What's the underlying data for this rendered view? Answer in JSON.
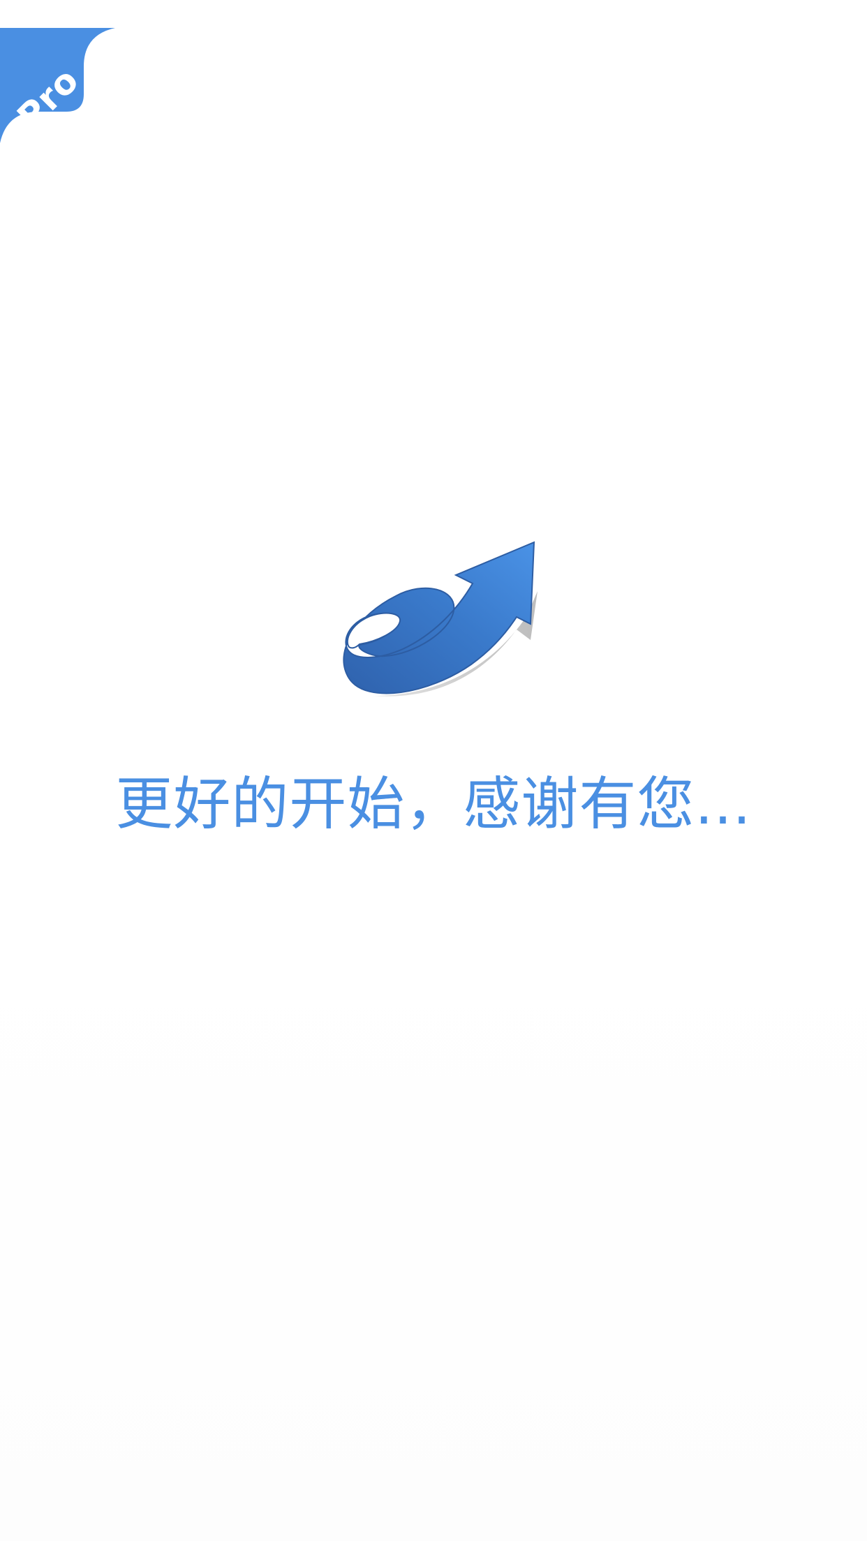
{
  "badge": {
    "label": "Pro",
    "color": "#4a8fe2"
  },
  "logo": {
    "icon": "e-arrow-logo-icon",
    "colors": {
      "light": "#4a90e2",
      "dark": "#2f62ad",
      "shadow": "#c9c9c9"
    }
  },
  "tagline": {
    "text": "更好的开始，感谢有您...",
    "color": "#4a8fe2"
  }
}
